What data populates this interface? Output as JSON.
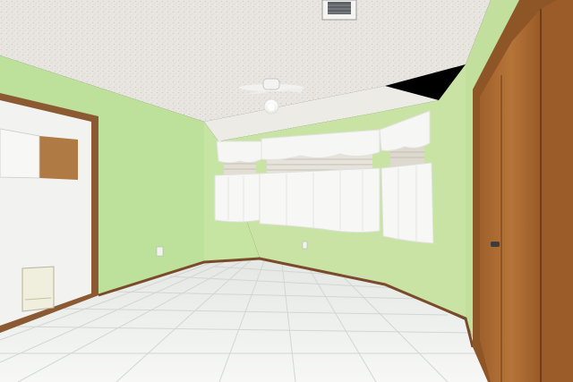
{
  "scene": {
    "subject": "empty-bedroom",
    "colors": {
      "ceiling": "#e9e6e1",
      "wall_left": "#bfe09a",
      "wall_back": "#c8e3a3",
      "wall_right": "#c3df9d",
      "floor": "#eef0ee",
      "grout": "#d2d6d4",
      "baseboard": "#7a4a2a",
      "door_trim": "#8b5a32",
      "closet_wood": "#a86a34",
      "closet_wood_dark": "#8e5526",
      "curtain": "#f6f6f4",
      "door_white": "#f2f2f0",
      "cork": "#b07a45"
    }
  }
}
